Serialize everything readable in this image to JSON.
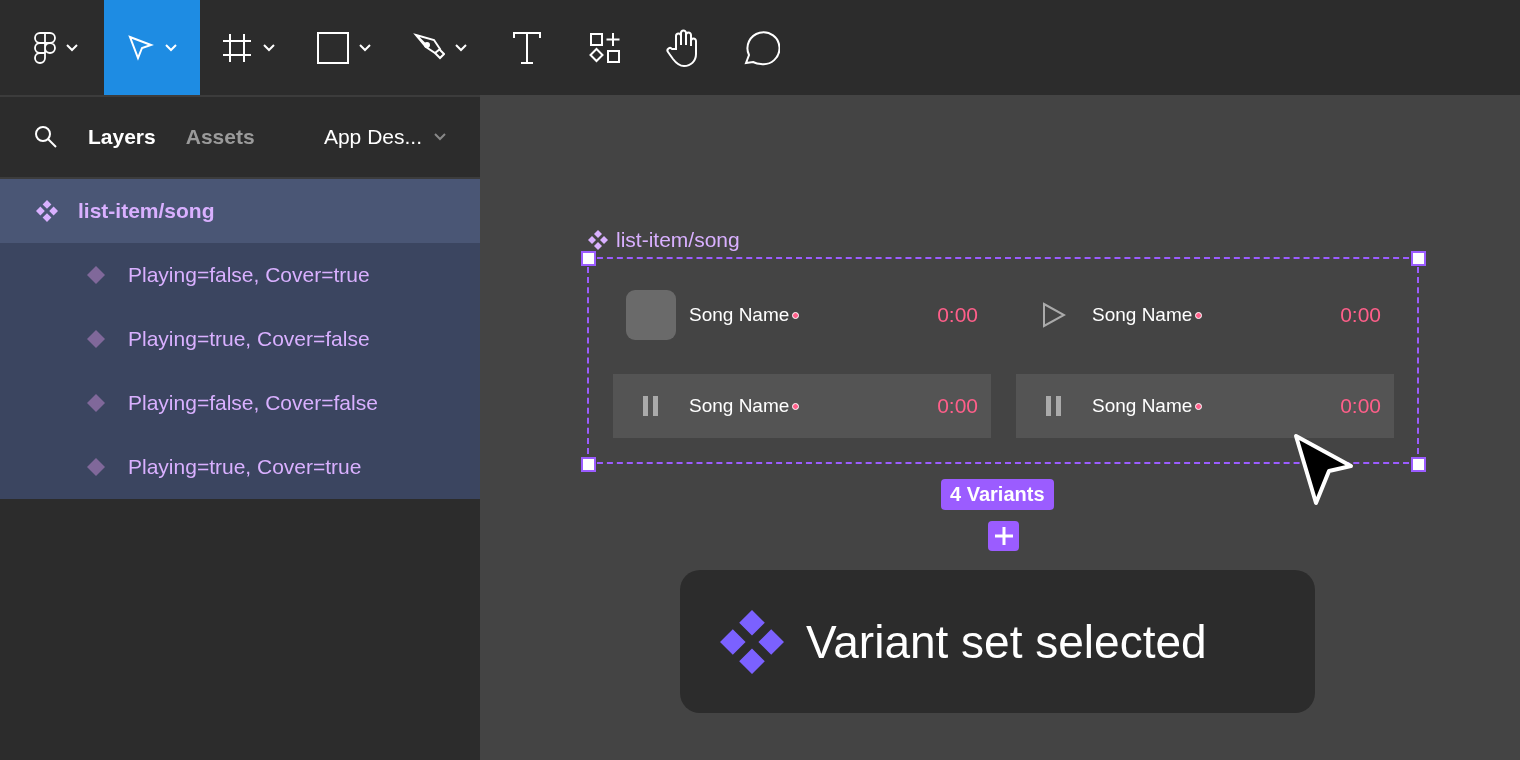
{
  "toolbar": {
    "tools": [
      {
        "kind": "logo",
        "selected": false,
        "menu": true
      },
      {
        "kind": "move",
        "selected": true,
        "menu": true
      },
      {
        "kind": "frame",
        "selected": false,
        "menu": true
      },
      {
        "kind": "rectangle",
        "selected": false,
        "menu": true
      },
      {
        "kind": "pen",
        "selected": false,
        "menu": true
      },
      {
        "kind": "text",
        "selected": false,
        "menu": false
      },
      {
        "kind": "components",
        "selected": false,
        "menu": false
      },
      {
        "kind": "hand",
        "selected": false,
        "menu": false
      },
      {
        "kind": "comment",
        "selected": false,
        "menu": false
      }
    ]
  },
  "panel": {
    "tabs": [
      {
        "label": "Layers",
        "selected": true
      },
      {
        "label": "Assets",
        "selected": false
      }
    ],
    "page": "App Des...",
    "layers": [
      {
        "name": "list-item/song",
        "selected": true,
        "children": [
          {
            "name": "Playing=false, Cover=true",
            "selected": false
          },
          {
            "name": "Playing=true, Cover=false",
            "selected": false
          },
          {
            "name": "Playing=false, Cover=false",
            "selected": false
          },
          {
            "name": "Playing=true, Cover=true",
            "selected": false
          }
        ]
      }
    ]
  },
  "canvas": {
    "frame_label": "list-item/song",
    "variants": [
      {
        "kind": "cover",
        "highlighted": false,
        "title": "Song Name",
        "time": "0:00"
      },
      {
        "kind": "play",
        "highlighted": false,
        "title": "Song Name",
        "time": "0:00"
      },
      {
        "kind": "pause",
        "highlighted": true,
        "title": "Song Name",
        "time": "0:00"
      },
      {
        "kind": "pause",
        "highlighted": true,
        "title": "Song Name",
        "time": "0:00"
      }
    ],
    "badge": "4 Variants",
    "toast": "Variant set selected"
  }
}
